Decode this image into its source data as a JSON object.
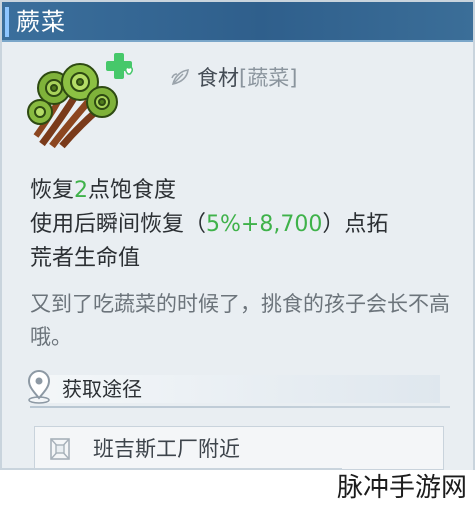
{
  "title": "蕨菜",
  "category": {
    "main": "食材",
    "sub": "[蔬菜]"
  },
  "effects": {
    "line1_prefix": "恢复",
    "line1_value": "2",
    "line1_suffix": "点饱食度",
    "line2_prefix": "使用后瞬间恢复（",
    "line2_value": "5%+8,700",
    "line2_suffix": "）点拓",
    "line3": "荒者生命值"
  },
  "flavor_text": "又到了吃蔬菜的时候了，挑食的孩子会长不高哦。",
  "source": {
    "header": "获取途径",
    "items": [
      "班吉斯工厂附近"
    ]
  },
  "watermark": "脉冲手游网",
  "colors": {
    "title_bar": "#2f5f8c",
    "highlight": "#3fb24a",
    "panel_bg": "#e9eef2"
  },
  "icons": [
    "fern-icon",
    "plus-heart-icon",
    "leaf-icon",
    "location-pin-icon",
    "map-marker-icon"
  ]
}
